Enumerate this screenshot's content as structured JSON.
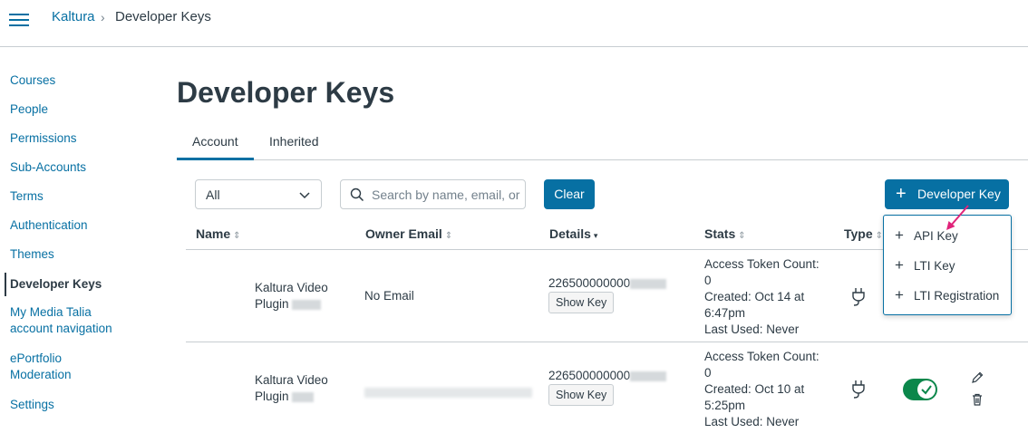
{
  "breadcrumb": {
    "root": "Kaltura",
    "separator": "›",
    "current": "Developer Keys"
  },
  "sidebar": {
    "items": [
      {
        "label": "Courses"
      },
      {
        "label": "People"
      },
      {
        "label": "Permissions"
      },
      {
        "label": "Sub-Accounts"
      },
      {
        "label": "Terms"
      },
      {
        "label": "Authentication"
      },
      {
        "label": "Themes"
      },
      {
        "label": "Developer Keys",
        "active": true
      },
      {
        "label": "My Media Talia account navigation"
      },
      {
        "label": "ePortfolio Moderation"
      },
      {
        "label": "Settings"
      }
    ]
  },
  "page": {
    "title": "Developer Keys"
  },
  "tabs": [
    {
      "label": "Account",
      "selected": true
    },
    {
      "label": "Inherited",
      "selected": false
    }
  ],
  "filters": {
    "select_value": "All",
    "search_placeholder": "Search by name, email, or ID",
    "search_value": "",
    "clear_label": "Clear"
  },
  "add_button": {
    "icon": "plus-icon",
    "label": "Developer Key"
  },
  "add_menu": {
    "items": [
      {
        "label": "API Key",
        "icon": "plus-icon"
      },
      {
        "label": "LTI Key",
        "icon": "plus-icon"
      },
      {
        "label": "LTI Registration",
        "icon": "plus-icon"
      }
    ]
  },
  "table": {
    "columns": [
      {
        "label": "Name",
        "sort": "⇕"
      },
      {
        "label": "Owner Email",
        "sort": "⇕"
      },
      {
        "label": "Details",
        "sort": "▾"
      },
      {
        "label": "Stats",
        "sort": "⇕"
      },
      {
        "label": "Type",
        "sort": "⇕"
      }
    ],
    "rows": [
      {
        "name_line1": "Kaltura Video",
        "name_line2": "Plugin",
        "owner_email": "No Email",
        "key_prefix": "226500000000",
        "show_key_label": "Show Key",
        "stats": {
          "token_label": "Access Token Count:",
          "token_count": "0",
          "created": "Created: Oct 14 at",
          "created_time": "6:47pm",
          "last_used": "Last Used: Never"
        },
        "type_icon": "plug-icon"
      },
      {
        "name_line1": "Kaltura Video",
        "name_line2": "Plugin",
        "owner_email": "",
        "key_prefix": "226500000000",
        "show_key_label": "Show Key",
        "stats": {
          "token_label": "Access Token Count:",
          "token_count": "0",
          "created": "Created: Oct 10 at",
          "created_time": "5:25pm",
          "last_used": "Last Used: Never"
        },
        "type_icon": "plug-icon",
        "state_on": true
      }
    ]
  },
  "colors": {
    "link": "#0770a3",
    "primary_button": "#0770a3",
    "toggle_on": "#0b874b",
    "annotation_arrow": "#e0237a"
  }
}
